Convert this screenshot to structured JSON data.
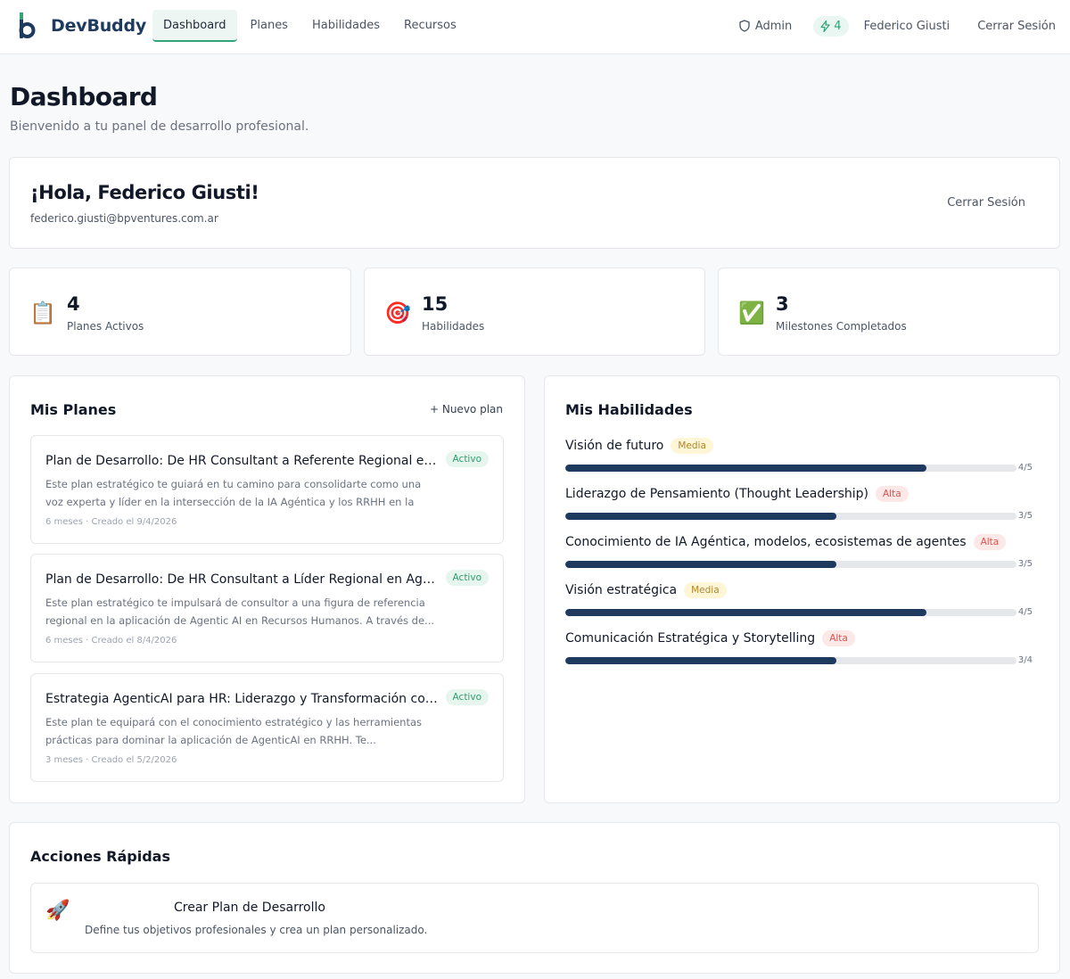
{
  "app": {
    "brand": "DevBuddy"
  },
  "nav": {
    "items": [
      {
        "label": "Dashboard",
        "active": true
      },
      {
        "label": "Planes",
        "active": false
      },
      {
        "label": "Habilidades",
        "active": false
      },
      {
        "label": "Recursos",
        "active": false
      }
    ],
    "admin_label": "Admin",
    "bolt_count": "4",
    "user_name": "Federico Giusti",
    "logout_label": "Cerrar Sesión"
  },
  "page": {
    "title": "Dashboard",
    "subtitle": "Bienvenido a tu panel de desarrollo profesional."
  },
  "greeting": {
    "title": "¡Hola, Federico Giusti!",
    "email": "federico.giusti@bpventures.com.ar",
    "logout_label": "Cerrar Sesión"
  },
  "stats": [
    {
      "icon": "clipboard-icon",
      "glyph": "📋",
      "value": "4",
      "label": "Planes Activos"
    },
    {
      "icon": "target-icon",
      "glyph": "🎯",
      "value": "15",
      "label": "Habilidades"
    },
    {
      "icon": "check-icon",
      "glyph": "✅",
      "value": "3",
      "label": "Milestones Completados"
    }
  ],
  "plans": {
    "title": "Mis Planes",
    "new_plan_label": "+ Nuevo plan",
    "items": [
      {
        "title": "Plan de Desarrollo: De HR Consultant a Referente Regional en Agentic AI",
        "status": "Activo",
        "description": "Este plan estratégico te guiará en tu camino para consolidarte como una voz experta y líder en la intersección de la IA Agéntica y los RRHH en la región....",
        "meta": "6 meses · Creado el 9/4/2026"
      },
      {
        "title": "Plan de Desarrollo: De HR Consultant a Líder Regional en Agentic AI",
        "status": "Activo",
        "description": "Este plan estratégico te impulsará de consultor a una figura de referencia regional en la aplicación de Agentic AI en Recursos Humanos. A través de...",
        "meta": "6 meses · Creado el 8/4/2026"
      },
      {
        "title": "Estrategia AgenticAI para HR: Liderazgo y Transformación como Consultor",
        "status": "Activo",
        "description": "Este plan te equipará con el conocimiento estratégico y las herramientas prácticas para dominar la aplicación de AgenticAI en RRHH. Te...",
        "meta": "3 meses · Creado el 5/2/2026"
      }
    ]
  },
  "skills": {
    "title": "Mis Habilidades",
    "items": [
      {
        "name": "Visión de futuro",
        "priority": "Media",
        "score": "4/5",
        "progress": 0.8
      },
      {
        "name": "Liderazgo de Pensamiento (Thought Leadership)",
        "priority": "Alta",
        "score": "3/5",
        "progress": 0.6
      },
      {
        "name": "Conocimiento de IA Agéntica, modelos, ecosistemas de agentes",
        "priority": "Alta",
        "score": "3/5",
        "progress": 0.6
      },
      {
        "name": "Visión estratégica",
        "priority": "Media",
        "score": "4/5",
        "progress": 0.8
      },
      {
        "name": "Comunicación Estratégica y Storytelling",
        "priority": "Alta",
        "score": "3/4",
        "progress": 0.6
      }
    ]
  },
  "quick_actions": {
    "title": "Acciones Rápidas",
    "items": [
      {
        "icon": "rocket-icon",
        "glyph": "🚀",
        "title": "Crear Plan de Desarrollo",
        "description": "Define tus objetivos profesionales y crea un plan personalizado."
      }
    ]
  },
  "colors": {
    "accent_green": "#34a37a",
    "navy": "#1e3a5f",
    "badge_media_bg": "#fef6d6",
    "badge_alta_bg": "#fde8e8"
  }
}
